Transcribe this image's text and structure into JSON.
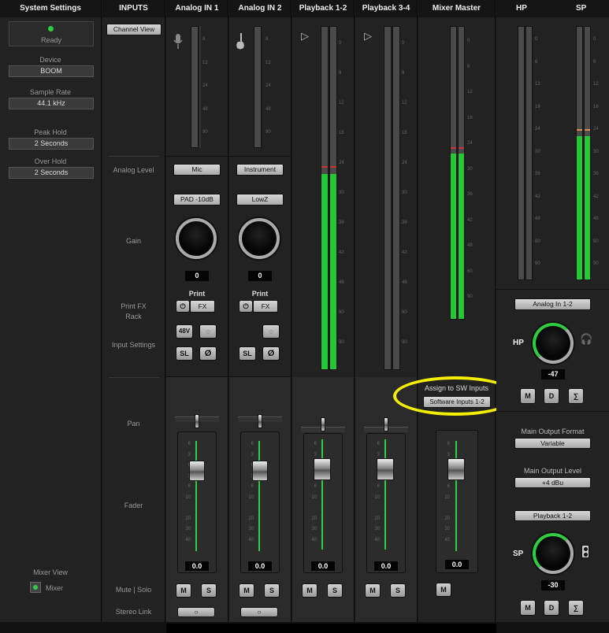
{
  "system": {
    "title": "System Settings",
    "status": "Ready",
    "device_label": "Device",
    "device": "BOOM",
    "sample_rate_label": "Sample Rate",
    "sample_rate": "44.1 kHz",
    "peak_hold_label": "Peak Hold",
    "peak_hold": "2 Seconds",
    "over_hold_label": "Over Hold",
    "over_hold": "2 Seconds",
    "mixer_view_label": "Mixer View",
    "mixer_option": "Mixer"
  },
  "inputs": {
    "title": "INPUTS",
    "channel_view": "Channel View",
    "analog_level": "Analog Level",
    "gain": "Gain",
    "print_fx_rack": "Print FX Rack",
    "input_settings": "Input Settings",
    "pan": "Pan",
    "fader": "Fader",
    "mute_solo": "Mute | Solo",
    "stereo_link": "Stereo Link"
  },
  "channels": {
    "analog1": {
      "title": "Analog IN 1",
      "level": "Mic",
      "pad": "PAD -10dB",
      "gain": "0",
      "print": "Print",
      "fx": "FX",
      "v48": "48V",
      "sl": "SL",
      "phase": "Ø",
      "fader": "0.0",
      "m": "M",
      "s": "S",
      "link": "○"
    },
    "analog2": {
      "title": "Analog IN 2",
      "level": "Instrument",
      "pad": "LowZ",
      "gain": "0",
      "print": "Print",
      "fx": "FX",
      "sl": "SL",
      "phase": "Ø",
      "fader": "0.0",
      "m": "M",
      "s": "S",
      "link": "○"
    },
    "pb12": {
      "title": "Playback 1-2",
      "fader": "0.0",
      "m": "M",
      "s": "S"
    },
    "pb34": {
      "title": "Playback 3-4",
      "fader": "0.0",
      "m": "M",
      "s": "S"
    },
    "master": {
      "title": "Mixer Master",
      "assign_label": "Assign to SW Inputs",
      "assign_value": "Software Inputs 1-2",
      "fader": "0.0",
      "m": "M"
    }
  },
  "output": {
    "hp_title": "HP",
    "sp_title": "SP",
    "hp_source": "Analog In 1-2",
    "hp_label": "HP",
    "hp_value": "-47",
    "main_format_label": "Main Output Format",
    "main_format": "Variable",
    "main_level_label": "Main Output Level",
    "main_level": "+4 dBu",
    "sp_source": "Playback 1-2",
    "sp_label": "SP",
    "sp_value": "-30",
    "m": "M",
    "d": "D",
    "sum": "∑"
  },
  "meter_scale": [
    "0",
    "6",
    "12",
    "18",
    "24",
    "30",
    "36",
    "42",
    "48",
    "60",
    "90"
  ],
  "fader_scale": [
    "6",
    "3",
    "0",
    "3",
    "6",
    "10",
    "20",
    "30",
    "40"
  ],
  "colors": {
    "meter_green": "#22c935",
    "highlight": "#f4ee00",
    "status": "#2ecc40"
  }
}
